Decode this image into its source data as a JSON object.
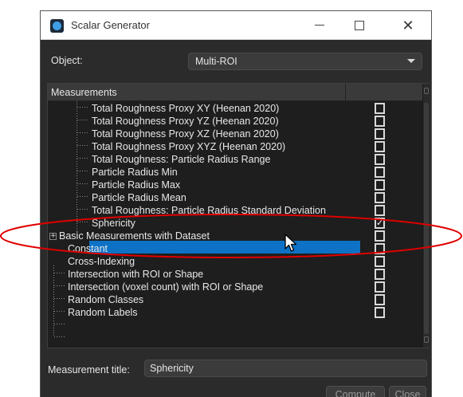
{
  "window": {
    "title": "Scalar Generator",
    "controls": {
      "minimize": "—",
      "maximize": "☐",
      "close": "✕"
    }
  },
  "object": {
    "label": "Object:",
    "value": "Multi-ROI"
  },
  "tree": {
    "header": "Measurements",
    "children": [
      {
        "label": "Total Roughness Proxy XY (Heenan 2020)",
        "checked": false
      },
      {
        "label": "Total Roughness Proxy YZ (Heenan 2020)",
        "checked": false
      },
      {
        "label": "Total Roughness Proxy XZ (Heenan 2020)",
        "checked": false
      },
      {
        "label": "Total Roughness Proxy XYZ (Heenan 2020)",
        "checked": false
      },
      {
        "label": "Total Roughness: Particle Radius Range",
        "checked": false
      },
      {
        "label": "Particle Radius Min",
        "checked": false
      },
      {
        "label": "Particle Radius Max",
        "checked": false
      },
      {
        "label": "Particle Radius Mean",
        "checked": false
      },
      {
        "label": "Total Roughness: Particle Radius Standard Deviation",
        "checked": false
      },
      {
        "label": "Sphericity",
        "checked": true,
        "selected": true
      }
    ],
    "top_items": [
      {
        "label": "Basic Measurements with Dataset",
        "expand": "+",
        "checked": false
      },
      {
        "label": "Constant",
        "checked": false
      },
      {
        "label": "Cross-Indexing",
        "checked": false
      },
      {
        "label": "Intersection with ROI or Shape",
        "checked": false
      },
      {
        "label": "Intersection (voxel count) with ROI or Shape",
        "checked": false
      },
      {
        "label": "Random Classes",
        "checked": false
      },
      {
        "label": "Random Labels",
        "checked": false
      }
    ]
  },
  "measurement_title": {
    "label": "Measurement title:",
    "value": "Sphericity"
  },
  "buttons": {
    "compute": "Compute",
    "close": "Close"
  },
  "colors": {
    "dialog_bg": "#2b2b2b",
    "tree_bg": "#1e1e1e",
    "selection": "#0d72c6",
    "annotation": "#e00000"
  }
}
